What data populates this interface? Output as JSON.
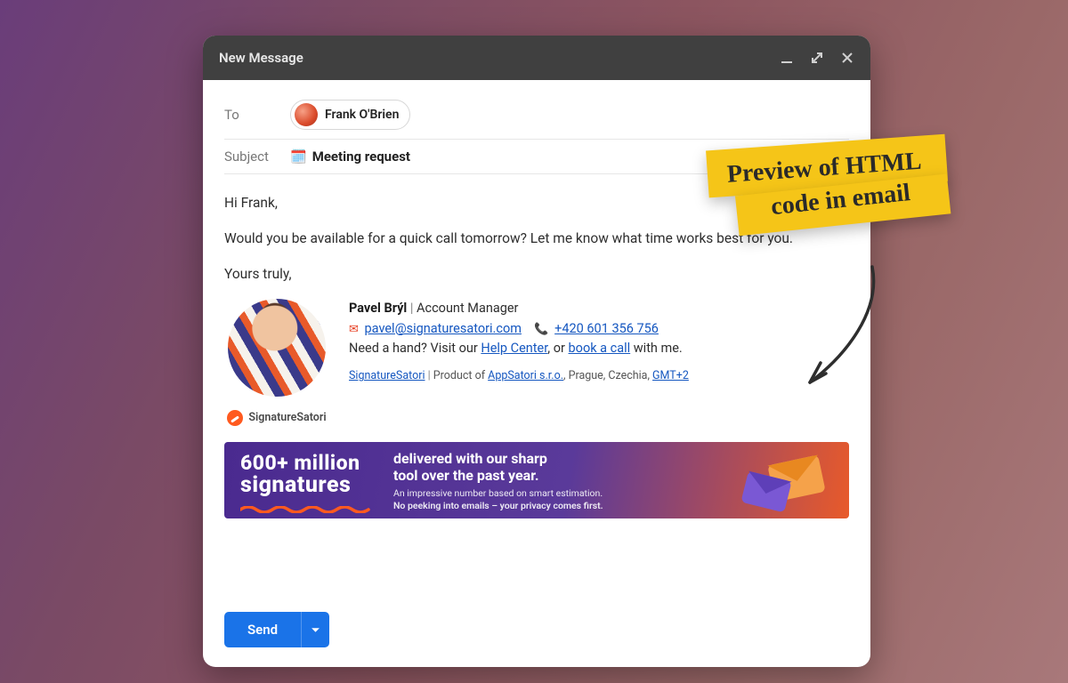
{
  "titlebar": {
    "title": "New Message"
  },
  "fields": {
    "to_label": "To",
    "recipient": "Frank O'Brien",
    "subject_label": "Subject",
    "subject_value": "Meeting request"
  },
  "body": {
    "greeting": "Hi Frank,",
    "paragraph": "Would you be available for a quick call tomorrow? Let me know what time works best for you.",
    "signoff": "Yours truly,"
  },
  "signature": {
    "name": "Pavel Brýl",
    "title": "Account Manager",
    "email": "pavel@signaturesatori.com",
    "phone": "+420 601 356 756",
    "help_pre": "Need a hand? Visit our ",
    "help_link": "Help Center",
    "help_mid": ", or ",
    "book_link": "book a call",
    "help_post": " with me.",
    "brand": "SignatureSatori",
    "footer_prod": "Product of ",
    "footer_company": "AppSatori s.r.o.",
    "footer_loc": ", Prague, Czechia, ",
    "footer_tz": "GMT+2",
    "brand_label": "SignatureSatori"
  },
  "banner": {
    "headline1": "600+ million",
    "headline2": "signatures",
    "sub1": "delivered with our sharp",
    "sub2": "tool over the past year.",
    "small1": "An impressive number based on smart estimation.",
    "small2": "No peeking into emails – your privacy comes first."
  },
  "actions": {
    "send": "Send"
  },
  "annotation": {
    "line1": "Preview of HTML",
    "line2": "code in email"
  }
}
